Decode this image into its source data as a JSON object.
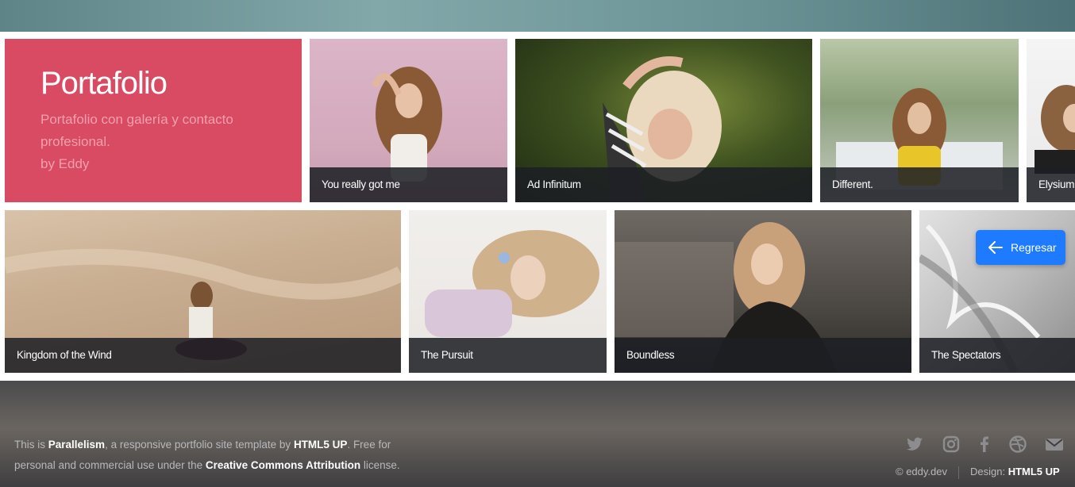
{
  "intro": {
    "title": "Portafolio",
    "subtitle_line1": "Portafolio con galería y contacto",
    "subtitle_line2": "profesional.",
    "subtitle_line3": "by Eddy"
  },
  "gallery": {
    "row1": [
      {
        "caption": "You really got me"
      },
      {
        "caption": "Ad Infinitum"
      },
      {
        "caption": "Different."
      },
      {
        "caption": "Elysium"
      }
    ],
    "row2": [
      {
        "caption": "Kingdom of the Wind"
      },
      {
        "caption": "The Pursuit"
      },
      {
        "caption": "Boundless"
      },
      {
        "caption": "The Spectators"
      }
    ]
  },
  "back_button": {
    "label": "Regresar",
    "icon": "arrow-left-icon",
    "color": "#1e7bff"
  },
  "footer": {
    "t1": "This is ",
    "t2": "Parallelism",
    "t3": ", a responsive portfolio site template by ",
    "t4": "HTML5 UP",
    "t5": ". Free for",
    "t6": "personal and commercial use under the ",
    "t7": "Creative Commons Attribution",
    "t8": " license.",
    "copyright": "© eddy.dev",
    "design_label": "Design: ",
    "design_value": "HTML5 UP",
    "socials": [
      "twitter-icon",
      "instagram-icon",
      "facebook-icon",
      "dribbble-icon",
      "email-icon"
    ]
  },
  "colors": {
    "accent": "#d94a63",
    "button": "#1e7bff"
  }
}
